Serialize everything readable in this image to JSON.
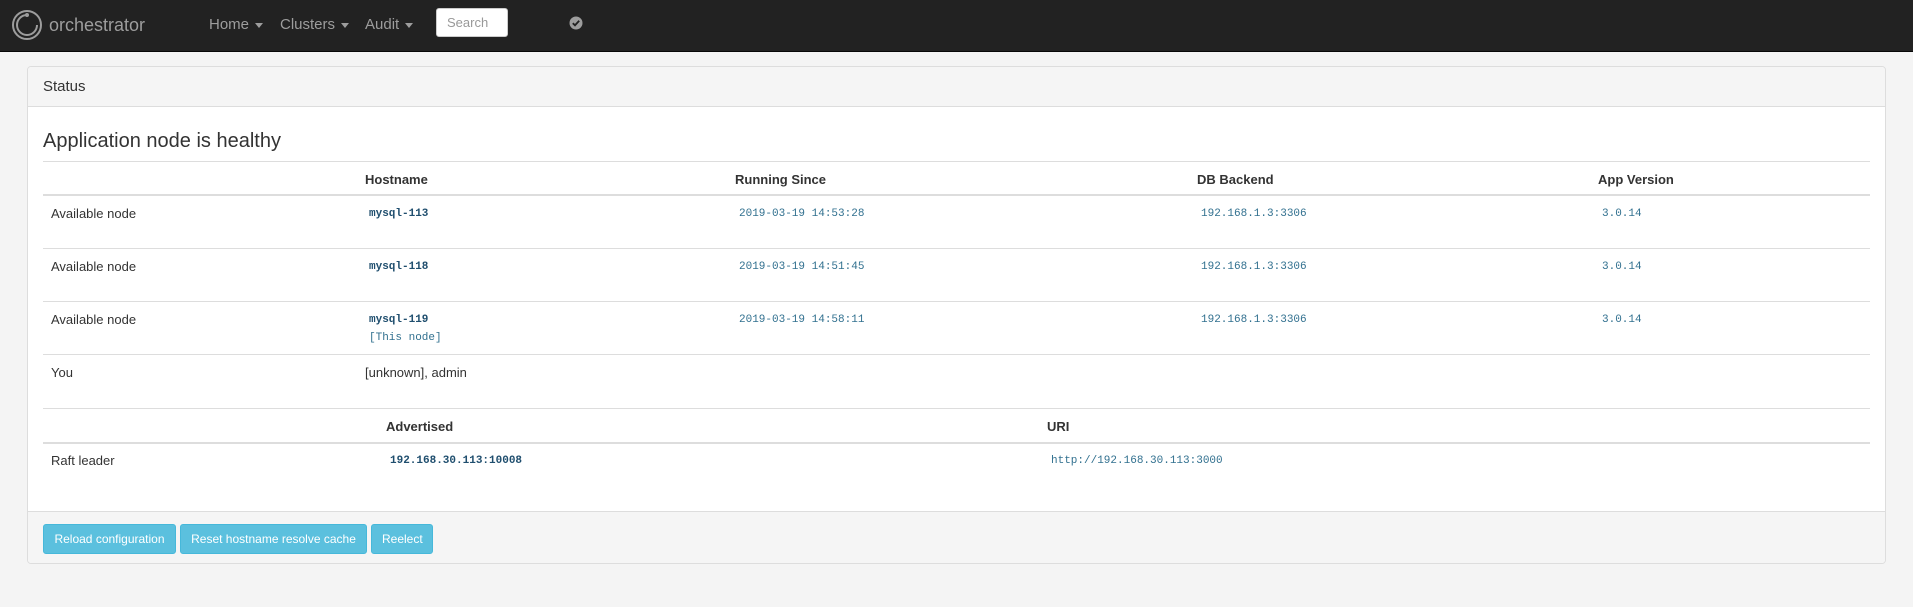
{
  "navbar": {
    "brand": "orchestrator",
    "menu": [
      {
        "label": "Home"
      },
      {
        "label": "Clusters"
      },
      {
        "label": "Audit"
      }
    ],
    "search_placeholder": "Search"
  },
  "panel": {
    "title": "Status",
    "heading": "Application node is healthy",
    "nodes_table": {
      "columns": [
        "Hostname",
        "Running Since",
        "DB Backend",
        "App Version"
      ],
      "rows": [
        {
          "label": "Available node",
          "hostname": "mysql-113",
          "note": "",
          "running_since": "2019-03-19 14:53:28",
          "db_backend": "192.168.1.3:3306",
          "app_version": "3.0.14"
        },
        {
          "label": "Available node",
          "hostname": "mysql-118",
          "note": "",
          "running_since": "2019-03-19 14:51:45",
          "db_backend": "192.168.1.3:3306",
          "app_version": "3.0.14"
        },
        {
          "label": "Available node",
          "hostname": "mysql-119",
          "note": "[This node]",
          "running_since": "2019-03-19 14:58:11",
          "db_backend": "192.168.1.3:3306",
          "app_version": "3.0.14"
        }
      ],
      "you": {
        "label": "You",
        "value": "[unknown], admin"
      }
    },
    "raft_table": {
      "columns": [
        "Advertised",
        "URI"
      ],
      "row": {
        "label": "Raft leader",
        "advertised": "192.168.30.113:10008",
        "uri": "http://192.168.30.113:3000"
      }
    },
    "buttons": {
      "reload": "Reload configuration",
      "reset": "Reset hostname resolve cache",
      "reelect": "Reelect"
    }
  },
  "colors": {
    "navbar_bg": "#222222",
    "nav_text": "#9d9d9d",
    "link_code": "#31708f",
    "button_info": "#5bc0de"
  }
}
